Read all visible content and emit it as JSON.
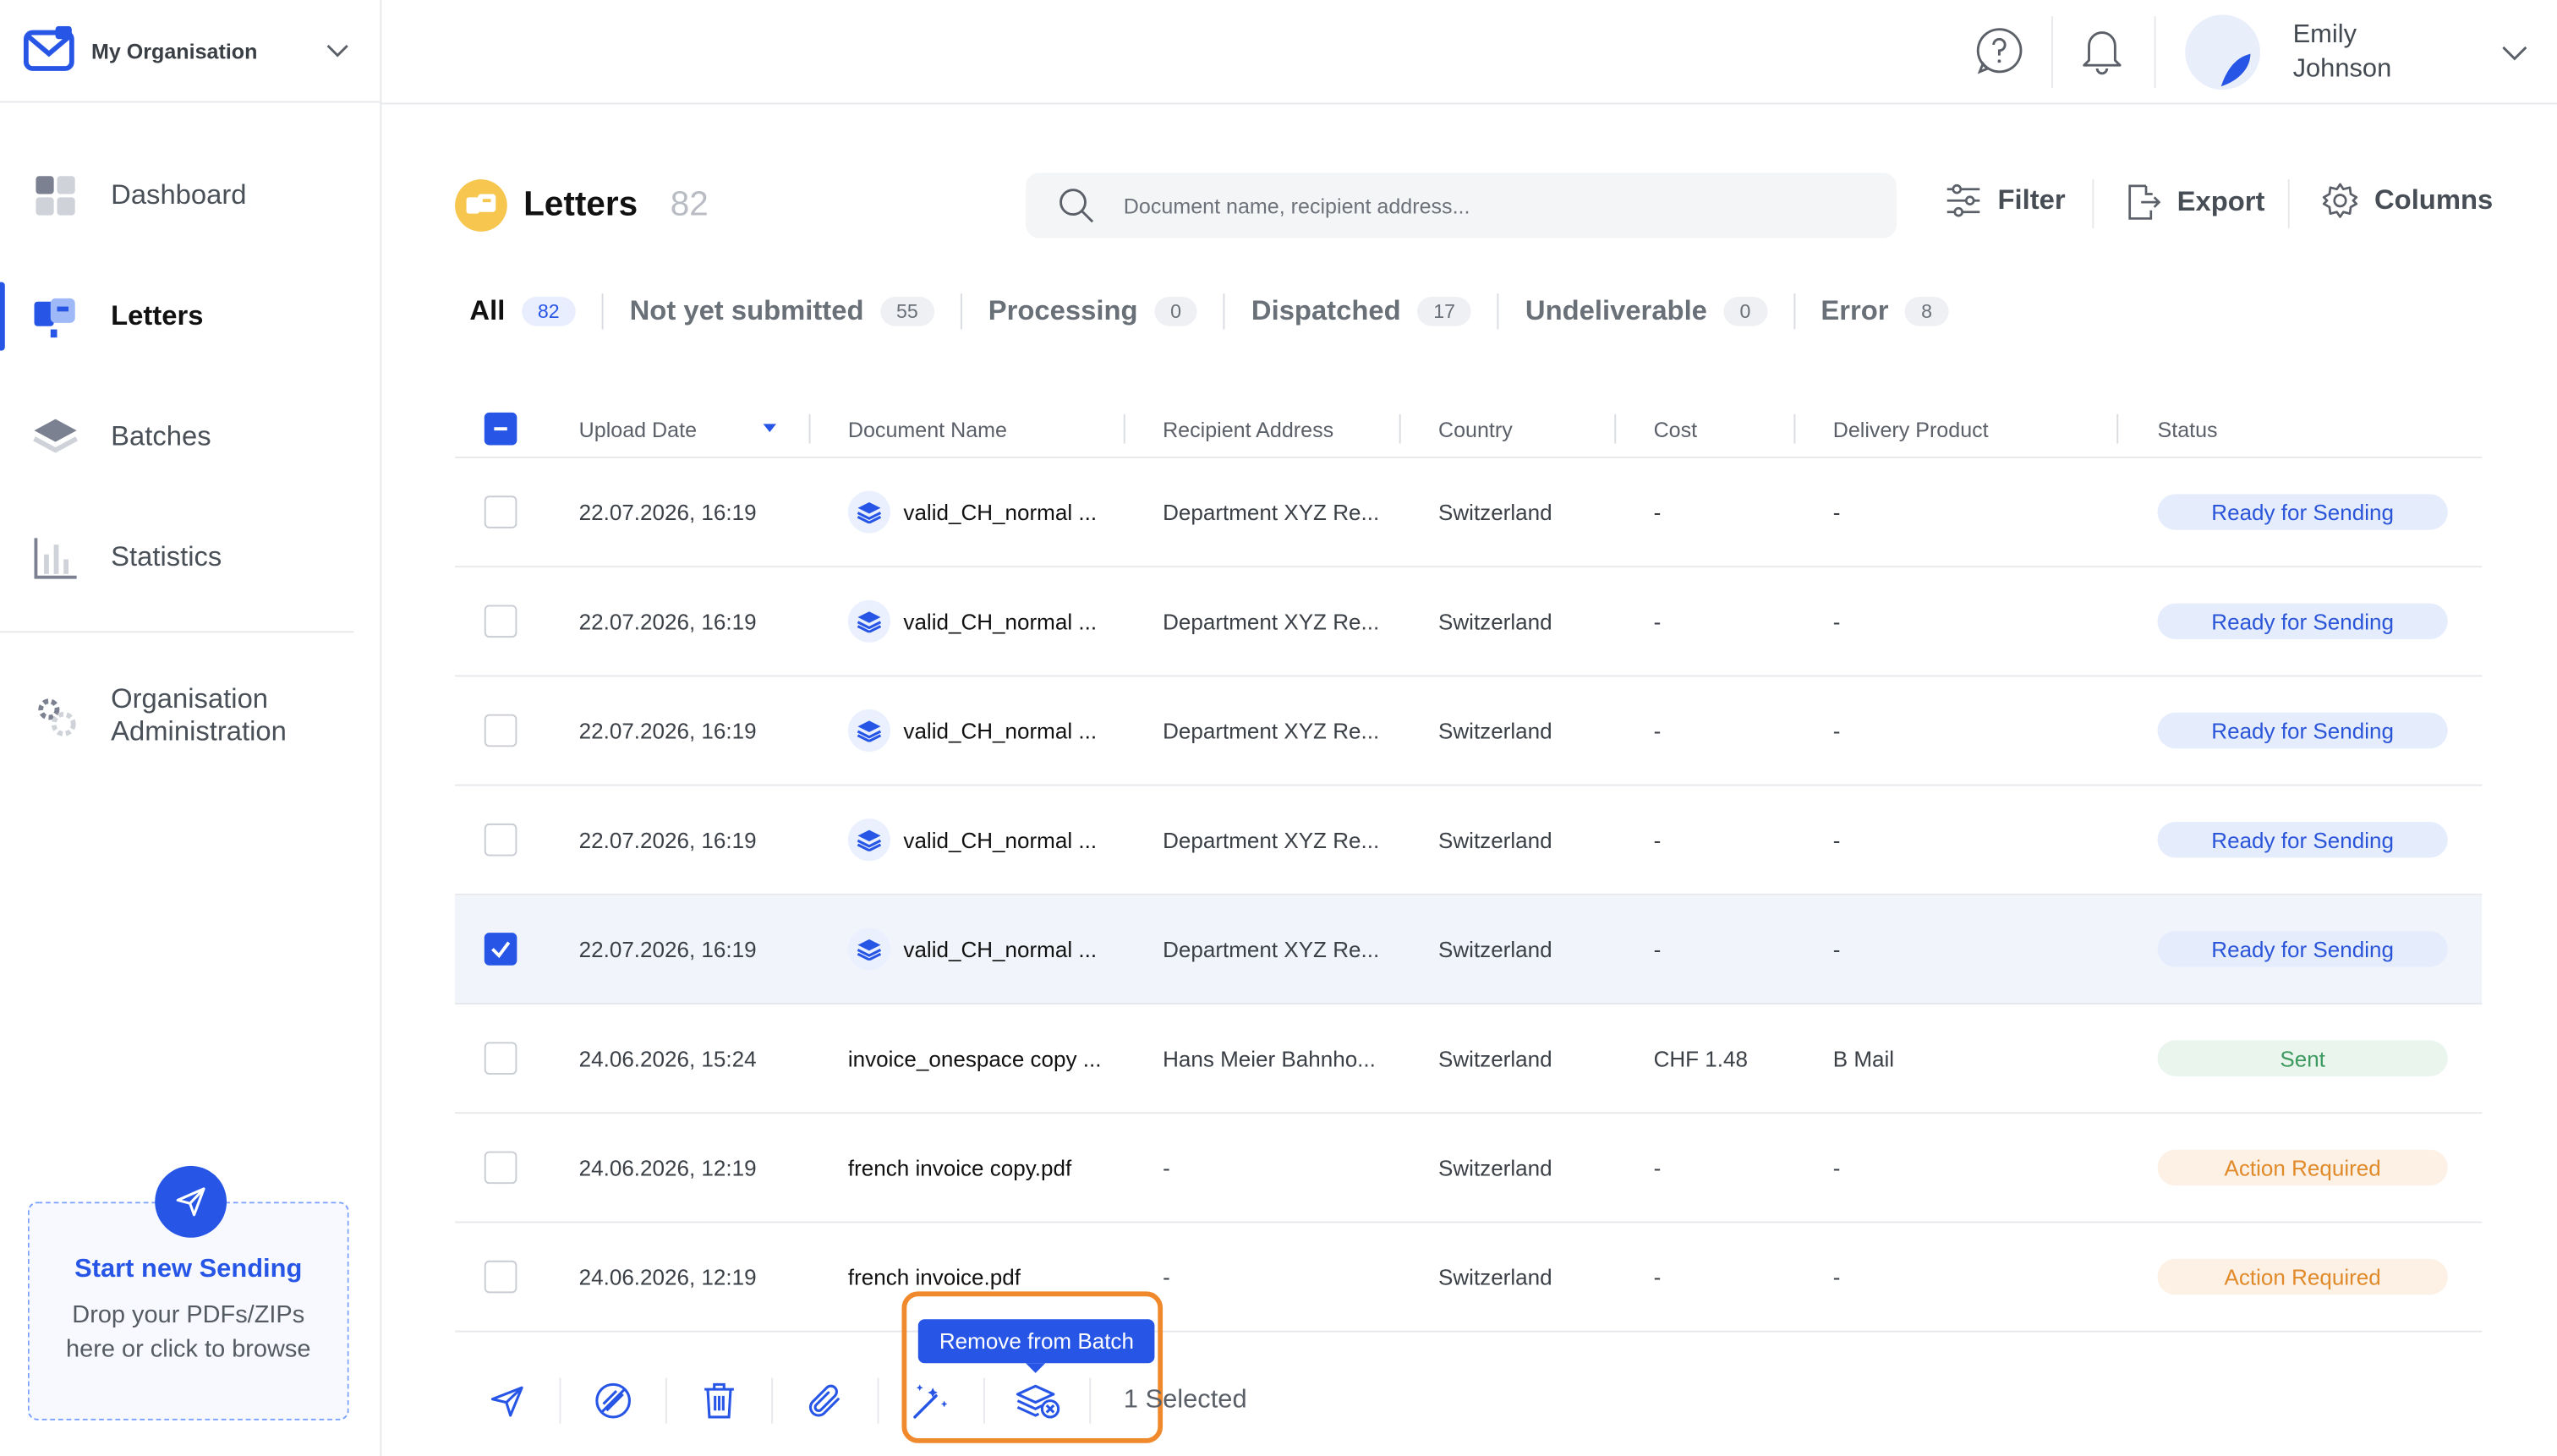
{
  "sidebar": {
    "org_name": "My Organisation",
    "items": [
      {
        "label": "Dashboard",
        "icon": "dashboard-icon"
      },
      {
        "label": "Letters",
        "icon": "letters-icon"
      },
      {
        "label": "Batches",
        "icon": "batches-icon"
      },
      {
        "label": "Statistics",
        "icon": "statistics-icon"
      },
      {
        "label": "Organisation Administration",
        "icon": "gear-icon"
      }
    ],
    "upload": {
      "title": "Start new Sending",
      "subtitle": "Drop your PDFs/ZIPs here or click to browse"
    }
  },
  "header": {
    "user_first": "Emily",
    "user_last": "Johnson"
  },
  "page": {
    "title": "Letters",
    "count": "82"
  },
  "search": {
    "placeholder": "Document name, recipient address..."
  },
  "toolbar": {
    "filter": "Filter",
    "export": "Export",
    "columns": "Columns"
  },
  "tabs": [
    {
      "label": "All",
      "count": "82"
    },
    {
      "label": "Not yet submitted",
      "count": "55"
    },
    {
      "label": "Processing",
      "count": "0"
    },
    {
      "label": "Dispatched",
      "count": "17"
    },
    {
      "label": "Undeliverable",
      "count": "0"
    },
    {
      "label": "Error",
      "count": "8"
    }
  ],
  "table": {
    "headers": {
      "upload_date": "Upload Date",
      "document_name": "Document Name",
      "recipient_address": "Recipient Address",
      "country": "Country",
      "cost": "Cost",
      "delivery_product": "Delivery Product",
      "status": "Status"
    },
    "rows": [
      {
        "date": "22.07.2026, 16:19",
        "doc": "valid_CH_normal ...",
        "addr": "Department XYZ Re...",
        "country": "Switzerland",
        "cost": "-",
        "product": "-",
        "status": "Ready for Sending",
        "checked": false,
        "batch": true
      },
      {
        "date": "22.07.2026, 16:19",
        "doc": "valid_CH_normal ...",
        "addr": "Department XYZ Re...",
        "country": "Switzerland",
        "cost": "-",
        "product": "-",
        "status": "Ready for Sending",
        "checked": false,
        "batch": true
      },
      {
        "date": "22.07.2026, 16:19",
        "doc": "valid_CH_normal ...",
        "addr": "Department XYZ Re...",
        "country": "Switzerland",
        "cost": "-",
        "product": "-",
        "status": "Ready for Sending",
        "checked": false,
        "batch": true
      },
      {
        "date": "22.07.2026, 16:19",
        "doc": "valid_CH_normal ...",
        "addr": "Department XYZ Re...",
        "country": "Switzerland",
        "cost": "-",
        "product": "-",
        "status": "Ready for Sending",
        "checked": false,
        "batch": true
      },
      {
        "date": "22.07.2026, 16:19",
        "doc": "valid_CH_normal ...",
        "addr": "Department XYZ Re...",
        "country": "Switzerland",
        "cost": "-",
        "product": "-",
        "status": "Ready for Sending",
        "checked": true,
        "batch": true
      },
      {
        "date": "24.06.2026, 15:24",
        "doc": "invoice_onespace copy ...",
        "addr": "Hans Meier Bahnho...",
        "country": "Switzerland",
        "cost": "CHF 1.48",
        "product": "B Mail",
        "status": "Sent",
        "checked": false,
        "batch": false
      },
      {
        "date": "24.06.2026, 12:19",
        "doc": "french invoice copy.pdf",
        "addr": "-",
        "country": "Switzerland",
        "cost": "-",
        "product": "-",
        "status": "Action Required",
        "checked": false,
        "batch": false
      },
      {
        "date": "24.06.2026, 12:19",
        "doc": "french invoice.pdf",
        "addr": "-",
        "country": "Switzerland",
        "cost": "-",
        "product": "-",
        "status": "Action Required",
        "checked": false,
        "batch": false
      }
    ]
  },
  "actions": {
    "tooltip": "Remove from Batch",
    "selected_text": "1 Selected",
    "icons": [
      "send-icon",
      "cancel-icon",
      "trash-icon",
      "attach-icon",
      "magic-wand-icon",
      "remove-from-batch-icon"
    ]
  },
  "colors": {
    "accent": "#2756e6",
    "ready": "#2a55d9",
    "sent": "#3c9a5f",
    "action_required": "#e08a2a",
    "highlight": "#f0892c"
  }
}
